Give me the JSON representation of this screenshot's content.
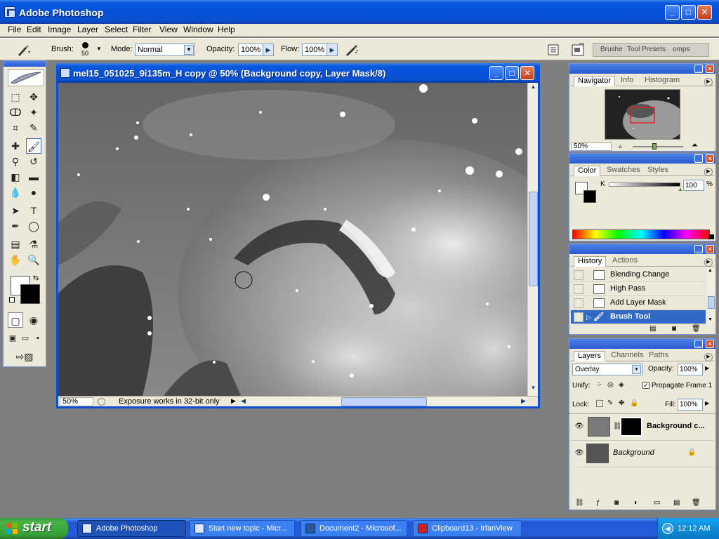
{
  "app": {
    "title": "Adobe Photoshop",
    "menus": [
      "File",
      "Edit",
      "Image",
      "Layer",
      "Select",
      "Filter",
      "View",
      "Window",
      "Help"
    ]
  },
  "options_bar": {
    "brush_label": "Brush:",
    "brush_size": "50",
    "mode_label": "Mode:",
    "mode_value": "Normal",
    "opacity_label": "Opacity:",
    "opacity_value": "100%",
    "flow_label": "Flow:",
    "flow_value": "100%",
    "well_tabs": [
      "Brushe",
      "Tool Presets",
      "omps"
    ]
  },
  "document": {
    "title": "mel15_051025_9i135m_H copy @ 50% (Background copy, Layer Mask/8)",
    "zoom": "50%",
    "status_info": "Exposure works in 32-bit only"
  },
  "navigator": {
    "tabs": [
      "Navigator",
      "Info",
      "Histogram"
    ],
    "zoom": "50%"
  },
  "color": {
    "tabs": [
      "Color",
      "Swatches",
      "Styles"
    ],
    "channel_label": "K",
    "channel_value": "100",
    "unit": "%"
  },
  "history": {
    "tabs": [
      "History",
      "Actions"
    ],
    "items": [
      "Blending Change",
      "High Pass",
      "Add Layer Mask",
      "Brush Tool"
    ],
    "active_index": 3
  },
  "layers": {
    "tabs": [
      "Layers",
      "Channels",
      "Paths"
    ],
    "blend_mode": "Overlay",
    "opacity_label": "Opacity:",
    "opacity_value": "100%",
    "unify_label": "Unify:",
    "propagate_label": "Propagate Frame 1",
    "lock_label": "Lock:",
    "fill_label": "Fill:",
    "fill_value": "100%",
    "items": [
      {
        "name": "Background c..."
      },
      {
        "name": "Background"
      }
    ]
  },
  "taskbar": {
    "start_label": "start",
    "tasks": [
      "Adobe Photoshop",
      "Start new topic - Micr...",
      "Document2 - Microsof...",
      "Clipboard13 - IrfanView"
    ],
    "clock": "12:12 AM"
  },
  "colors": {
    "xp_blue": "#0a4fd0",
    "selection": "#316ac5",
    "panel_bg": "#ece9d8",
    "desktop": "#7f7f7f"
  },
  "icons": [
    "photoshop-icon",
    "brush-icon",
    "eye-icon",
    "lock-icon",
    "airbrush-icon",
    "trash-icon",
    "camera-icon"
  ]
}
